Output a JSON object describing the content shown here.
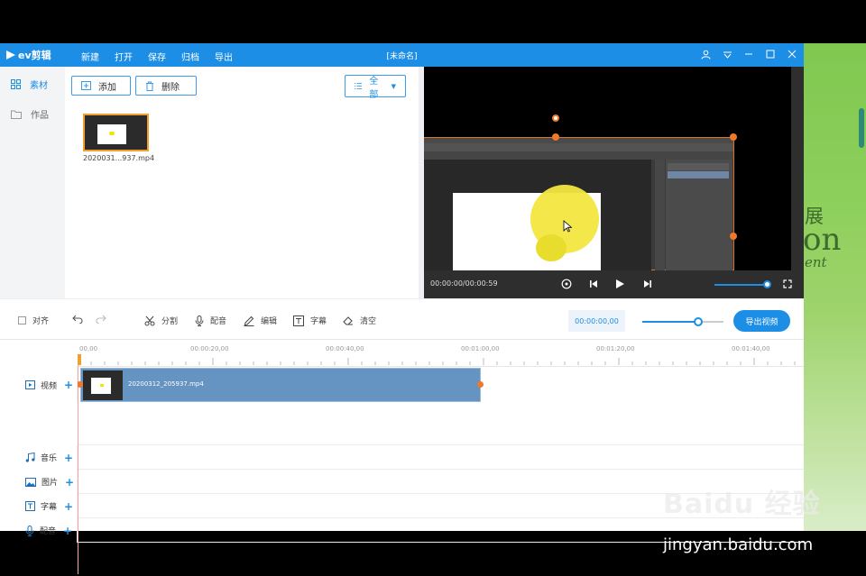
{
  "app": {
    "brand": "ev剪辑",
    "doc_title": "[未命名]",
    "menu": [
      "新建",
      "打开",
      "保存",
      "归档",
      "导出"
    ]
  },
  "sidebar": {
    "items": [
      {
        "label": "素材",
        "icon": "grid-icon",
        "active": true
      },
      {
        "label": "作品",
        "icon": "folder-icon",
        "active": false
      }
    ]
  },
  "library": {
    "add_label": "添加",
    "delete_label": "删除",
    "filter_label": "全部",
    "files": [
      {
        "name": "2020031...937.mp4"
      }
    ]
  },
  "preview": {
    "timecode": "00:00:00/00:00:59"
  },
  "toolbar": {
    "align_label": "对齐",
    "split_label": "分割",
    "dub_label": "配音",
    "edit_label": "编辑",
    "subtitle_label": "字幕",
    "clear_label": "清空",
    "current_time": "00:00:00,00",
    "export_label": "导出视频"
  },
  "timeline": {
    "ruler": [
      "00,00",
      "00:00:20,00",
      "00:00:40,00",
      "00:01:00,00",
      "00:01:20,00",
      "00:01:40,00"
    ],
    "tracks": [
      {
        "label": "视频",
        "icon": "video-icon"
      },
      {
        "label": "音乐",
        "icon": "music-icon"
      },
      {
        "label": "图片",
        "icon": "image-icon"
      },
      {
        "label": "字幕",
        "icon": "text-icon"
      },
      {
        "label": "配音",
        "icon": "mic-icon"
      }
    ],
    "clip_name": "20200312_205937.mp4"
  },
  "background": {
    "text1": "展",
    "text2": "on",
    "text3": "ent"
  },
  "watermark": {
    "logo": "Baidu 经验",
    "url": "jingyan.baidu.com"
  },
  "colors": {
    "accent": "#1c8ee6",
    "clip": "#6593c2",
    "handle": "#f07828"
  }
}
